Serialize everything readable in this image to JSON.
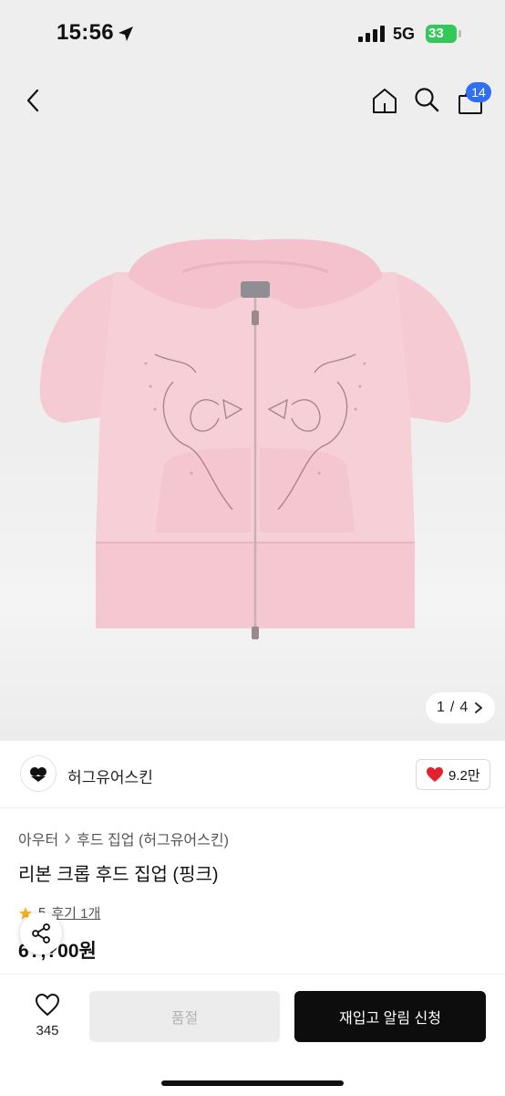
{
  "status_bar": {
    "time": "15:56",
    "network": "5G",
    "battery": "33"
  },
  "nav": {
    "cart_count": "14"
  },
  "gallery": {
    "current": "1",
    "total": "4",
    "separator": "/"
  },
  "brand": {
    "name": "허그유어스킨",
    "likes": "9.2만"
  },
  "product": {
    "category": "아우터",
    "subcategory": "후드 집업 (허그유어스킨)",
    "title": "리본 크롭 후드 집업 (핑크)",
    "rating": "5",
    "reviews": "후기 1개",
    "price": "6?,?00원"
  },
  "bottom_bar": {
    "wish_count": "345",
    "soldout_label": "품절",
    "restock_label": "재입고 알림 신청"
  },
  "colors": {
    "accent": "#2f6ff0",
    "battery": "#34c759",
    "heart": "#e5202e",
    "garment": "#f6cad3"
  }
}
